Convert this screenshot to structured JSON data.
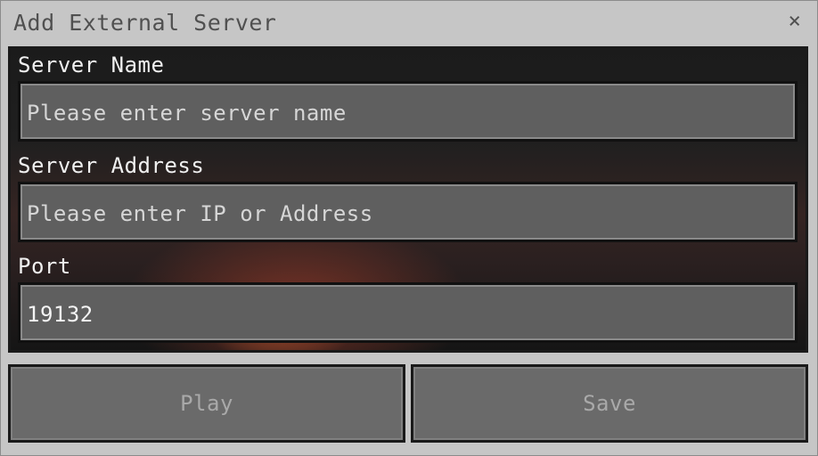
{
  "dialog": {
    "title": "Add External Server",
    "close_label": "×"
  },
  "form": {
    "server_name_label": "Server Name",
    "server_name_placeholder": "Please enter server name",
    "server_name_value": "",
    "server_address_label": "Server Address",
    "server_address_placeholder": "Please enter IP or Address",
    "server_address_value": "",
    "port_label": "Port",
    "port_value": "19132"
  },
  "buttons": {
    "play_label": "Play",
    "save_label": "Save"
  },
  "colors": {
    "dialog_background": "#c6c6c6",
    "field_background": "#5f5f5f",
    "button_background": "#6a6a6a",
    "disabled_text": "#a9a9a9"
  }
}
